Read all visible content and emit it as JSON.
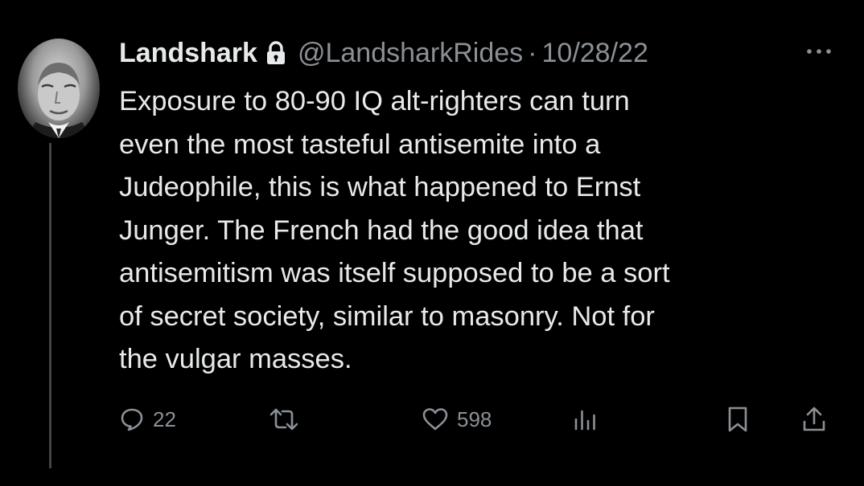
{
  "tweet": {
    "author_name": "Landshark",
    "handle": "@LandsharkRides",
    "separator": "·",
    "date": "10/28/22",
    "body": "Exposure to 80-90 IQ alt-righters can turn\neven the most tasteful antisemite into a\nJudeophile, this is what happened to Ernst\nJunger. The French had the good idea that\nantisemitism was itself supposed to be a sort\nof secret society, similar to masonry. Not for\nthe vulgar masses."
  },
  "actions": {
    "replies": "22",
    "likes": "598"
  },
  "icons": [
    "lock-icon",
    "more-icon",
    "reply-icon",
    "retweet-icon",
    "like-icon",
    "views-icon",
    "bookmark-icon",
    "share-icon"
  ],
  "colors": {
    "background": "#000000",
    "text": "#e7e9ea",
    "secondary": "#8b9096",
    "thread_line": "#3f4347"
  }
}
